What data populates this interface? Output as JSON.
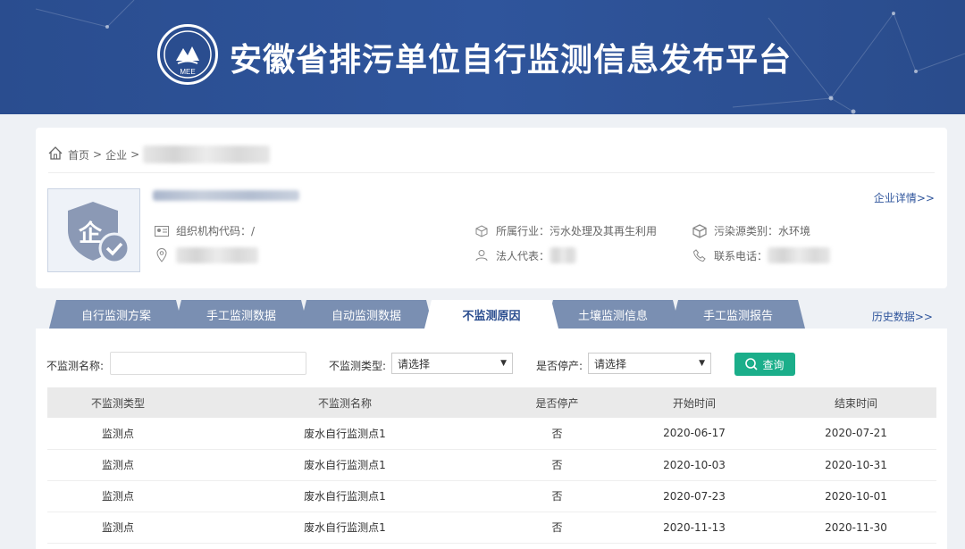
{
  "header": {
    "title": "安徽省排污单位自行监测信息发布平台",
    "logo_text": "MEE"
  },
  "breadcrumb": {
    "home": "首页",
    "sep1": ">",
    "enterprise": "企业",
    "sep2": ">"
  },
  "enterprise": {
    "detail_link": "企业详情>>",
    "avatar_text": "企",
    "org_code_label": "组织机构代码：/",
    "industry_label": "所属行业：污水处理及其再生利用",
    "pollution_label": "污染源类别：水环境",
    "legal_label": "法人代表：",
    "phone_label": "联系电话："
  },
  "tabs": [
    {
      "label": "自行监测方案"
    },
    {
      "label": "手工监测数据"
    },
    {
      "label": "自动监测数据"
    },
    {
      "label": "不监测原因"
    },
    {
      "label": "土壤监测信息"
    },
    {
      "label": "手工监测报告"
    }
  ],
  "history_link": "历史数据>>",
  "filters": {
    "name_label": "不监测名称:",
    "name_value": "",
    "type_label": "不监测类型:",
    "type_value": "请选择",
    "stop_label": "是否停产:",
    "stop_value": "请选择",
    "search_label": "查询"
  },
  "table": {
    "headers": [
      "不监测类型",
      "不监测名称",
      "是否停产",
      "开始时间",
      "结束时间"
    ],
    "rows": [
      [
        "监测点",
        "废水自行监测点1",
        "否",
        "2020-06-17",
        "2020-07-21"
      ],
      [
        "监测点",
        "废水自行监测点1",
        "否",
        "2020-10-03",
        "2020-10-31"
      ],
      [
        "监测点",
        "废水自行监测点1",
        "否",
        "2020-07-23",
        "2020-10-01"
      ],
      [
        "监测点",
        "废水自行监测点1",
        "否",
        "2020-11-13",
        "2020-11-30"
      ]
    ]
  },
  "colors": {
    "banner": "#2a4d8f",
    "tab": "#7a8fb2",
    "accent": "#1bae8a",
    "link": "#2f559c"
  }
}
